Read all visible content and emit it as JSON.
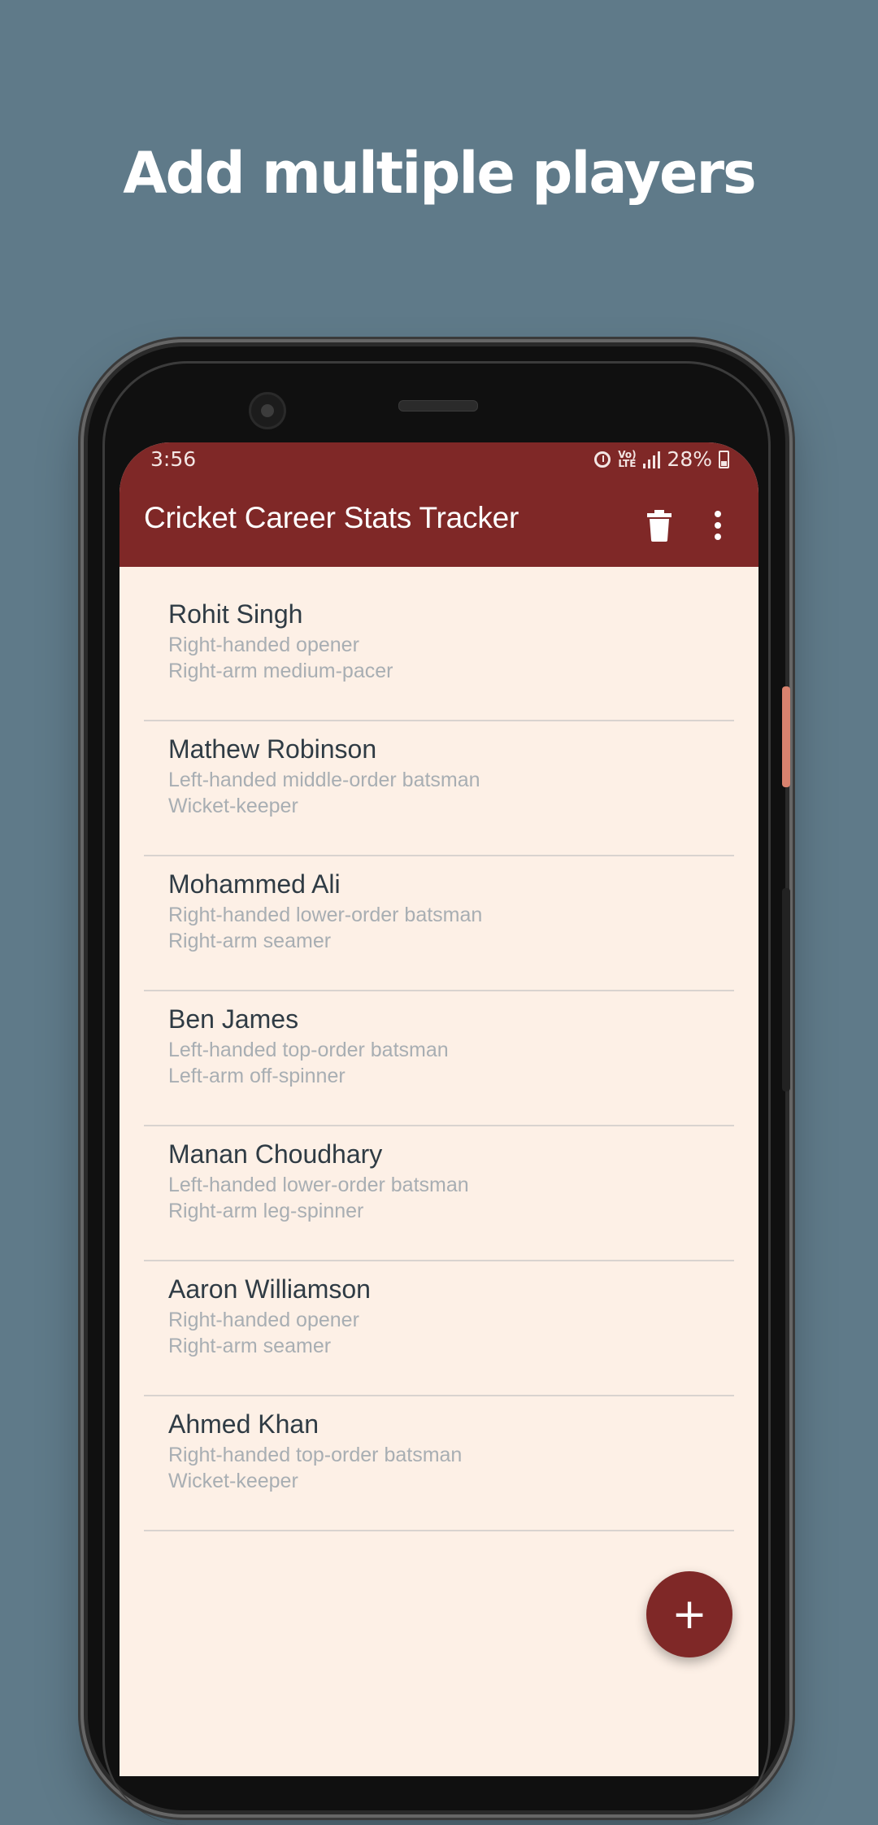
{
  "headline": "Add multiple players",
  "status_bar": {
    "time": "3:56",
    "lte_label": "Vo) LTE",
    "battery": "28%"
  },
  "app_bar": {
    "title": "Cricket Career Stats Tracker"
  },
  "players": [
    {
      "name": "Rohit Singh",
      "batting": "Right-handed opener",
      "bowling": "Right-arm medium-pacer"
    },
    {
      "name": "Mathew Robinson",
      "batting": "Left-handed middle-order batsman",
      "bowling": "Wicket-keeper"
    },
    {
      "name": "Mohammed Ali",
      "batting": "Right-handed lower-order batsman",
      "bowling": "Right-arm seamer"
    },
    {
      "name": "Ben James",
      "batting": "Left-handed top-order batsman",
      "bowling": "Left-arm off-spinner"
    },
    {
      "name": "Manan Choudhary",
      "batting": "Left-handed lower-order batsman",
      "bowling": "Right-arm leg-spinner"
    },
    {
      "name": "Aaron Williamson",
      "batting": "Right-handed opener",
      "bowling": "Right-arm seamer"
    },
    {
      "name": "Ahmed Khan",
      "batting": "Right-handed top-order batsman",
      "bowling": "Wicket-keeper"
    }
  ],
  "fab": {
    "icon": "plus-icon",
    "label": "+"
  },
  "colors": {
    "background": "#5f7a89",
    "primary": "#7f2827",
    "surface": "#fdf0e6"
  }
}
